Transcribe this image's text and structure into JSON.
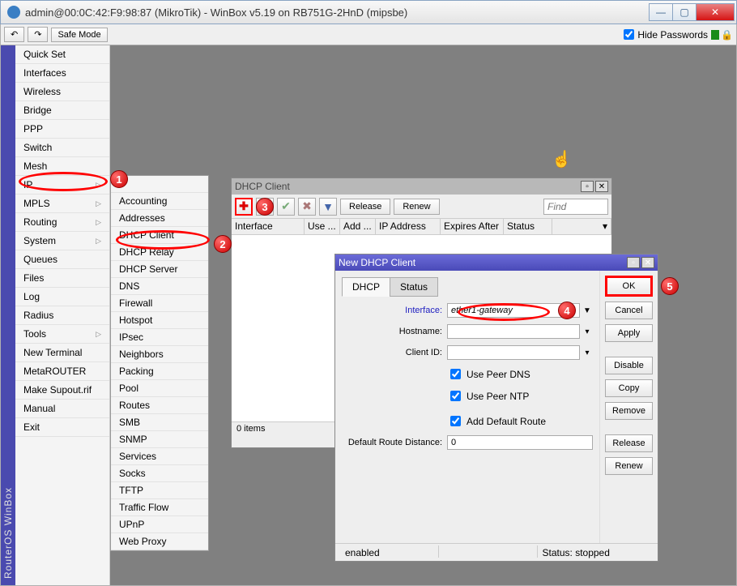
{
  "window": {
    "title": "admin@00:0C:42:F9:98:87 (MikroTik) - WinBox v5.19 on RB751G-2HnD (mipsbe)"
  },
  "toptool": {
    "safe_mode": "Safe Mode",
    "hide_pw": "Hide Passwords"
  },
  "brand": "RouterOS WinBox",
  "menu": [
    {
      "label": "Quick Set",
      "sub": false
    },
    {
      "label": "Interfaces",
      "sub": false
    },
    {
      "label": "Wireless",
      "sub": false
    },
    {
      "label": "Bridge",
      "sub": false
    },
    {
      "label": "PPP",
      "sub": false
    },
    {
      "label": "Switch",
      "sub": false
    },
    {
      "label": "Mesh",
      "sub": false
    },
    {
      "label": "IP",
      "sub": true
    },
    {
      "label": "MPLS",
      "sub": true
    },
    {
      "label": "Routing",
      "sub": true
    },
    {
      "label": "System",
      "sub": true
    },
    {
      "label": "Queues",
      "sub": false
    },
    {
      "label": "Files",
      "sub": false
    },
    {
      "label": "Log",
      "sub": false
    },
    {
      "label": "Radius",
      "sub": false
    },
    {
      "label": "Tools",
      "sub": true
    },
    {
      "label": "New Terminal",
      "sub": false
    },
    {
      "label": "MetaROUTER",
      "sub": false
    },
    {
      "label": "Make Supout.rif",
      "sub": false
    },
    {
      "label": "Manual",
      "sub": false
    },
    {
      "label": "Exit",
      "sub": false
    }
  ],
  "submenu": [
    "P",
    "Accounting",
    "Addresses",
    "DHCP Client",
    "DHCP Relay",
    "DHCP Server",
    "DNS",
    "Firewall",
    "Hotspot",
    "IPsec",
    "Neighbors",
    "Packing",
    "Pool",
    "Routes",
    "SMB",
    "SNMP",
    "Services",
    "Socks",
    "TFTP",
    "Traffic Flow",
    "UPnP",
    "Web Proxy"
  ],
  "dhcpwin": {
    "title": "DHCP Client",
    "release": "Release",
    "renew": "Renew",
    "find": "Find",
    "cols": [
      "Interface",
      "Use ...",
      "Add ...",
      "IP Address",
      "Expires After",
      "Status"
    ],
    "status": "0 items"
  },
  "newwin": {
    "title": "New DHCP Client",
    "tabs": [
      "DHCP",
      "Status"
    ],
    "labels": {
      "interface": "Interface:",
      "hostname": "Hostname:",
      "clientid": "Client ID:",
      "peerdns": "Use Peer DNS",
      "peerntp": "Use Peer NTP",
      "defroute": "Add Default Route",
      "distance": "Default Route Distance:"
    },
    "values": {
      "interface": "ether1-gateway",
      "hostname": "",
      "clientid": "",
      "peerdns": true,
      "peerntp": true,
      "defroute": true,
      "distance": "0"
    },
    "buttons": {
      "ok": "OK",
      "cancel": "Cancel",
      "apply": "Apply",
      "disable": "Disable",
      "copy": "Copy",
      "remove": "Remove",
      "release": "Release",
      "renew": "Renew"
    },
    "sb": {
      "state": "enabled",
      "status": "Status: stopped"
    }
  },
  "annot": {
    "1": "1",
    "2": "2",
    "3": "3",
    "4": "4",
    "5": "5"
  }
}
